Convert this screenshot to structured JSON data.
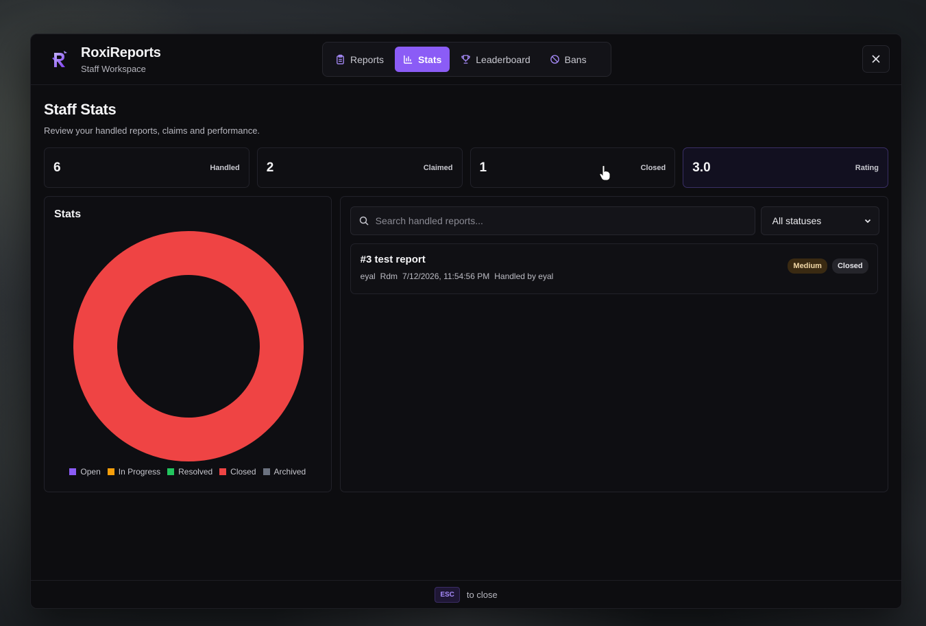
{
  "app": {
    "title": "RoxiReports",
    "subtitle": "Staff Workspace"
  },
  "tabs": [
    {
      "label": "Reports",
      "icon": "clipboard-icon",
      "active": false
    },
    {
      "label": "Stats",
      "icon": "bar-chart-icon",
      "active": true
    },
    {
      "label": "Leaderboard",
      "icon": "trophy-icon",
      "active": false
    },
    {
      "label": "Bans",
      "icon": "ban-icon",
      "active": false
    }
  ],
  "page": {
    "title": "Staff Stats",
    "description": "Review your handled reports, claims and performance."
  },
  "stats": [
    {
      "value": "6",
      "label": "Handled"
    },
    {
      "value": "2",
      "label": "Claimed"
    },
    {
      "value": "1",
      "label": "Closed"
    },
    {
      "value": "3.0",
      "label": "Rating"
    }
  ],
  "chart_panel": {
    "title": "Stats"
  },
  "chart_data": {
    "type": "pie",
    "categories": [
      "Open",
      "In Progress",
      "Resolved",
      "Closed",
      "Archived"
    ],
    "values": [
      0,
      0,
      0,
      1,
      0
    ],
    "colors": [
      "#8b5cf6",
      "#f59e0b",
      "#22c55e",
      "#ef4444",
      "#6b7280"
    ],
    "legend_position": "bottom"
  },
  "search": {
    "placeholder": "Search handled reports..."
  },
  "status_filter": {
    "selected": "All statuses"
  },
  "reports": [
    {
      "title": "#3 test report",
      "meta": [
        "eyal",
        "Rdm",
        "7/12/2026, 11:54:56 PM",
        "Handled by eyal"
      ],
      "priority": "Medium",
      "status": "Closed"
    }
  ],
  "footer": {
    "key": "ESC",
    "text": "to close"
  }
}
